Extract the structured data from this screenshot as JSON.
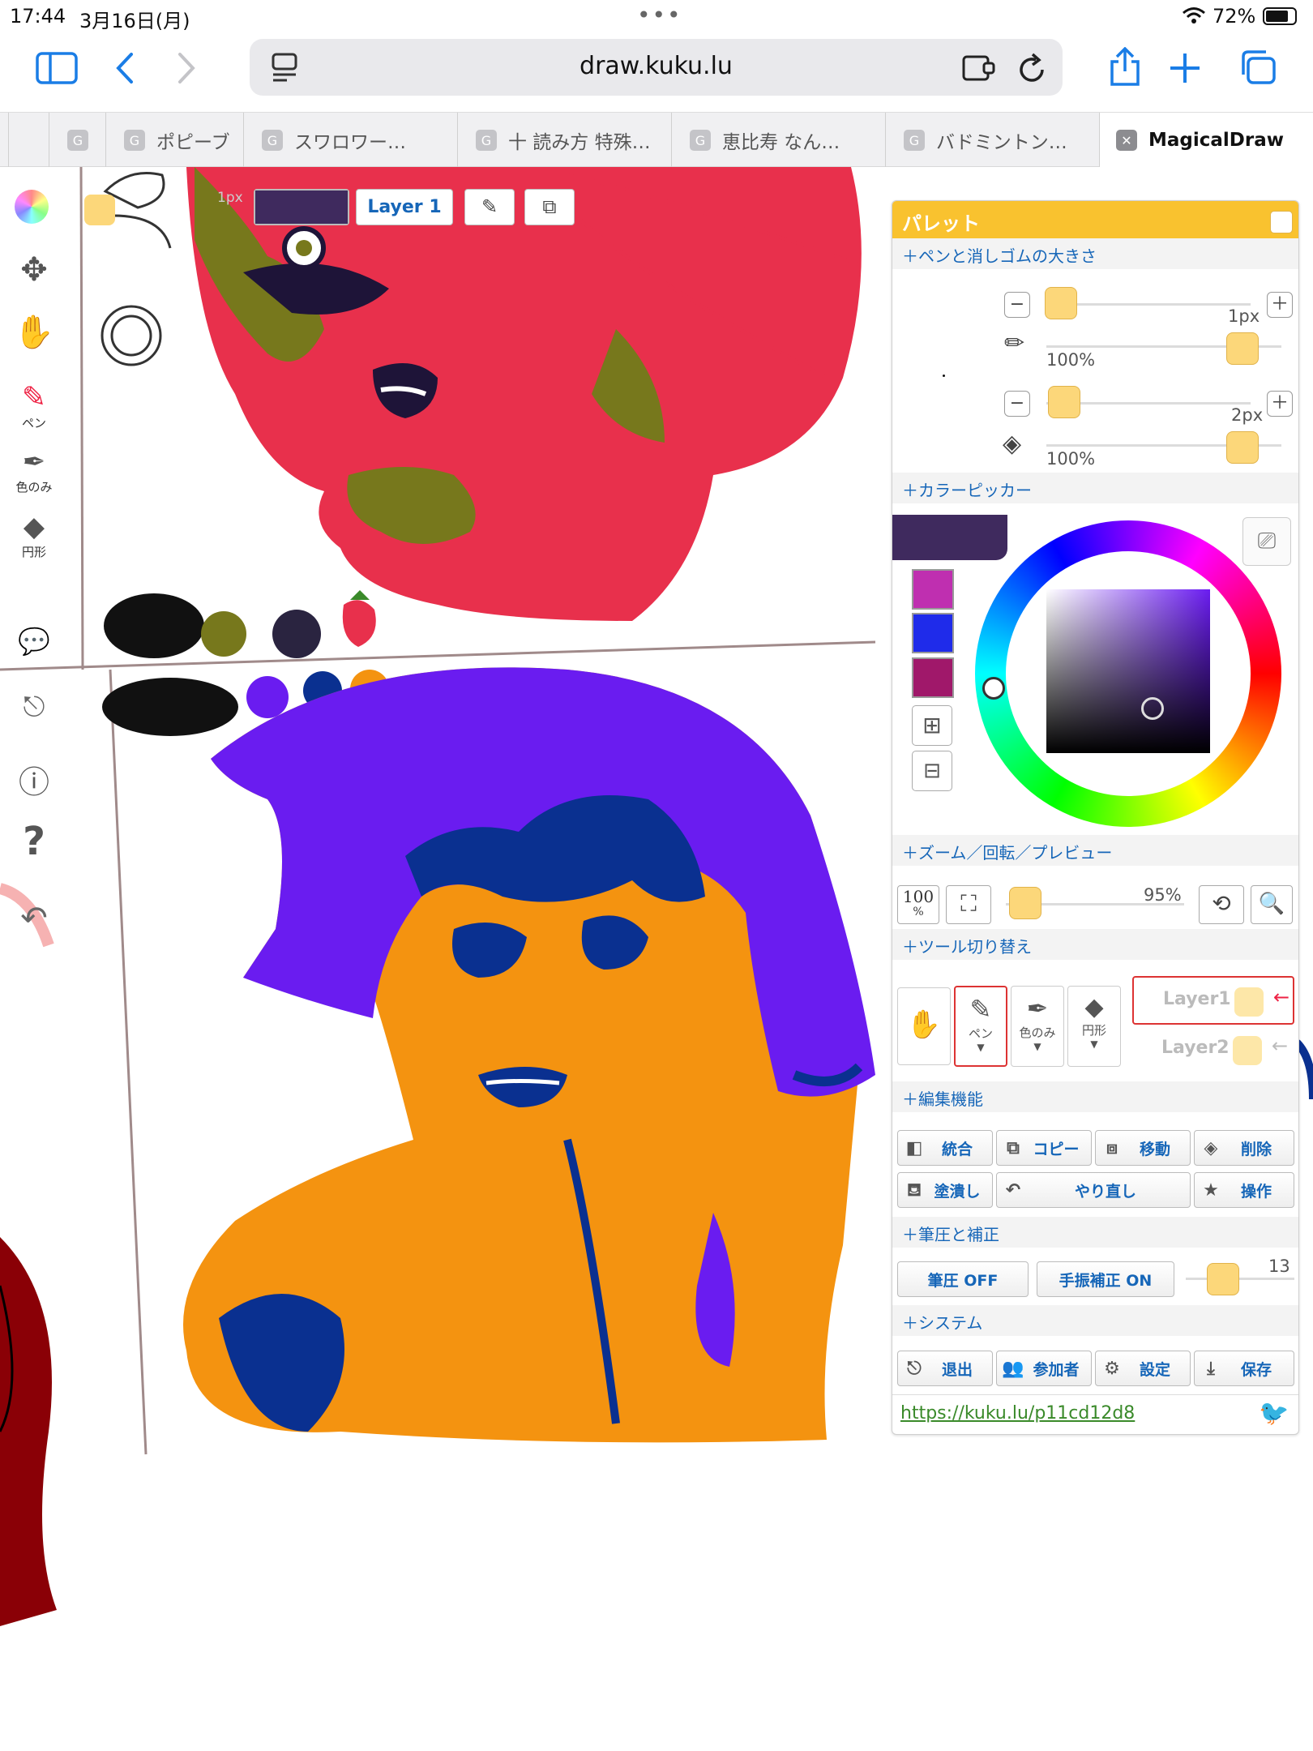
{
  "status": {
    "time": "17:44",
    "date": "3月16日(月)",
    "battery": "72%"
  },
  "browser": {
    "url": "draw.kuku.lu",
    "tabs": [
      {
        "label": "ポピーブ"
      },
      {
        "label": "スワロワー…"
      },
      {
        "label": "十 読み方 特殊…"
      },
      {
        "label": "恵比寿 なん…"
      },
      {
        "label": "バドミントン…"
      },
      {
        "label": "MagicalDraw"
      }
    ],
    "tab_icon_letter": "G"
  },
  "canvas": {
    "overlay_size": "1px",
    "layer_label": "Layer 1",
    "current_color": "#3f2a5e"
  },
  "tools_left": {
    "pen": "ペン",
    "eyedropper": "色のみ",
    "shape": "円形"
  },
  "palette": {
    "title": "パレット",
    "sections": {
      "pen_size": "＋ペンと消しゴムの大きさ",
      "color_picker": "＋カラーピッカー",
      "zoom": "＋ズーム／回転／プレビュー",
      "tool_switch": "＋ツール切り替え",
      "edit": "＋編集機能",
      "pressure": "＋筆圧と補正",
      "system": "＋システム"
    },
    "pen": {
      "size": "1px",
      "opacity": "100%",
      "size_fraction": 0.0,
      "opacity_fraction": 1.0
    },
    "eraser": {
      "size": "2px",
      "opacity": "100%",
      "size_fraction": 0.02,
      "opacity_fraction": 1.0
    },
    "swatches": [
      "#bf2fb0",
      "#1f2bea",
      "#a0186a"
    ],
    "zoom": {
      "reset_label": "100",
      "reset_unit": "%",
      "value": "95%"
    },
    "tool_labels": {
      "pen": "ペン",
      "eyedropper": "色のみ",
      "shape": "円形"
    },
    "layers": [
      "Layer1",
      "Layer2"
    ],
    "edit_buttons": {
      "merge": "統合",
      "copy": "コピー",
      "move": "移動",
      "delete": "削除",
      "fill": "塗潰し",
      "redo": "やり直し",
      "operate": "操作"
    },
    "pressure": {
      "pressure_btn": "筆圧 OFF",
      "stabilizer_btn": "手振補正 ON",
      "value": "13"
    },
    "system_buttons": {
      "exit": "退出",
      "participants": "参加者",
      "settings": "設定",
      "save": "保存"
    },
    "share_link": "https://kuku.lu/p11cd12d8"
  },
  "colors": {
    "accent": "#f9c22f",
    "link": "#1666b8",
    "safari_blue": "#1a7de6"
  }
}
